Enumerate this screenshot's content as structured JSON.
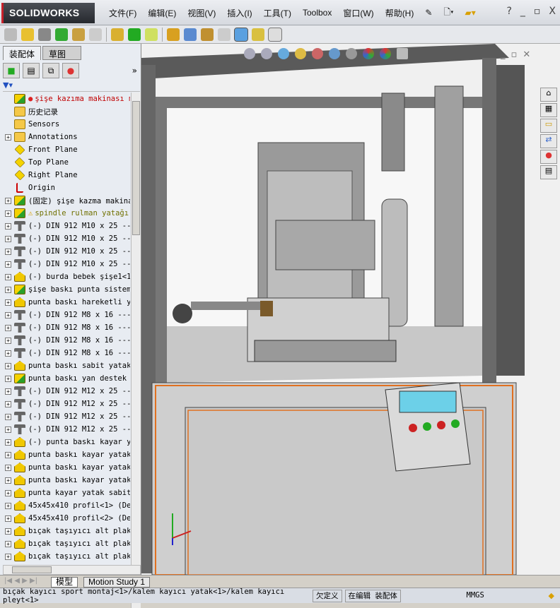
{
  "app": {
    "brand": "SOLIDWORKS"
  },
  "menu": [
    "文件(F)",
    "编辑(E)",
    "视图(V)",
    "插入(I)",
    "工具(T)",
    "Toolbox",
    "窗口(W)",
    "帮助(H)"
  ],
  "window_controls": {
    "help": "?",
    "minimize": "_",
    "restore": "▫",
    "close": "X"
  },
  "panel_tabs": [
    "装配体",
    "草图"
  ],
  "panel_more": "»",
  "tree": [
    {
      "icon": "assembly",
      "label": "şişe kazıma makinası montaj",
      "color": "#c00000",
      "expand": false,
      "warn": "rebuild"
    },
    {
      "icon": "folder",
      "label": "历史记录",
      "expand": false
    },
    {
      "icon": "folder",
      "label": "Sensors",
      "expand": false
    },
    {
      "icon": "folder",
      "label": "Annotations",
      "expand": true
    },
    {
      "icon": "plane",
      "label": "Front Plane",
      "expand": false
    },
    {
      "icon": "plane",
      "label": "Top Plane",
      "expand": false
    },
    {
      "icon": "plane",
      "label": "Right Plane",
      "expand": false
    },
    {
      "icon": "origin",
      "label": "Origin",
      "expand": false
    },
    {
      "icon": "assembly",
      "label": "(固定) şişe kazma makinası",
      "expand": true
    },
    {
      "icon": "assembly",
      "label": "spindle rulman yatağı",
      "color": "#707000",
      "expand": true,
      "warn": "warning"
    },
    {
      "icon": "bolt",
      "label": "(-) DIN 912 M10 x 25 ---",
      "expand": true
    },
    {
      "icon": "bolt",
      "label": "(-) DIN 912 M10 x 25 ---",
      "expand": true
    },
    {
      "icon": "bolt",
      "label": "(-) DIN 912 M10 x 25 ---",
      "expand": true
    },
    {
      "icon": "bolt",
      "label": "(-) DIN 912 M10 x 25 ---",
      "expand": true
    },
    {
      "icon": "part",
      "label": "(-) burda bebek şişe1<1>",
      "expand": true
    },
    {
      "icon": "assembly",
      "label": "şişe baskı punta sistemi",
      "expand": true
    },
    {
      "icon": "part",
      "label": "punta baskı hareketli yatak",
      "expand": true
    },
    {
      "icon": "bolt",
      "label": "(-) DIN 912 M8 x 16 ---",
      "expand": true
    },
    {
      "icon": "bolt",
      "label": "(-) DIN 912 M8 x 16 ---",
      "expand": true
    },
    {
      "icon": "bolt",
      "label": "(-) DIN 912 M8 x 16 ---",
      "expand": true
    },
    {
      "icon": "bolt",
      "label": "(-) DIN 912 M8 x 16 ---",
      "expand": true
    },
    {
      "icon": "part",
      "label": "punta baskı sabit yatak<",
      "expand": true
    },
    {
      "icon": "assembly",
      "label": "punta baskı yan destek m",
      "expand": true
    },
    {
      "icon": "bolt",
      "label": "(-) DIN 912 M12 x 25 ---",
      "expand": true
    },
    {
      "icon": "bolt",
      "label": "(-) DIN 912 M12 x 25 ---",
      "expand": true
    },
    {
      "icon": "bolt",
      "label": "(-) DIN 912 M12 x 25 ---",
      "expand": true
    },
    {
      "icon": "bolt",
      "label": "(-) DIN 912 M12 x 25 ---",
      "expand": true
    },
    {
      "icon": "part",
      "label": "(-) punta baskı kayar ya",
      "expand": true
    },
    {
      "icon": "part",
      "label": "punta baskı kayar yatak",
      "expand": true
    },
    {
      "icon": "part",
      "label": "punta baskı kayar yatak",
      "expand": true
    },
    {
      "icon": "part",
      "label": "punta baskı kayar yatak",
      "expand": true
    },
    {
      "icon": "part",
      "label": "punta kayar yatak sabit",
      "expand": true
    },
    {
      "icon": "part",
      "label": "45x45x410 profil<1> (De",
      "expand": true
    },
    {
      "icon": "part",
      "label": "45x45x410 profil<2> (De",
      "expand": true
    },
    {
      "icon": "part",
      "label": "bıçak taşıyıcı alt plaka y",
      "expand": true
    },
    {
      "icon": "part",
      "label": "bıçak taşıyıcı alt plaka y",
      "expand": true
    },
    {
      "icon": "part",
      "label": "bıçak taşıyıcı alt plaka y",
      "expand": true
    }
  ],
  "bottom_tabs": [
    "模型",
    "Motion Study 1"
  ],
  "status": {
    "path": "bıçak kayıcı sport montaj<1>/kalem kayıcı yatak<1>/kalem kayıcı pleyt<1>",
    "definition": "欠定义",
    "mode": "在编辑 装配体",
    "units": "MMGS"
  },
  "colors": {
    "accent_orange": "#e07020",
    "frame": "#6e6e6e",
    "screen": "#6cd0e8"
  }
}
